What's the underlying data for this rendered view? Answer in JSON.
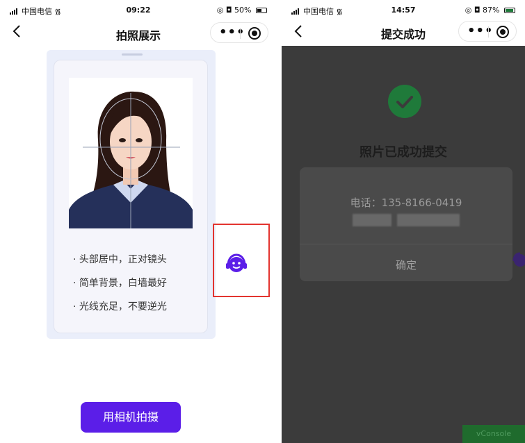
{
  "left": {
    "status": {
      "carrier": "中国电信",
      "time": "09:22",
      "battery": "50%"
    },
    "nav": {
      "back": "<",
      "title": "拍照展示"
    },
    "tips": [
      "· 头部居中，正对镜头",
      "· 简单背景，白墙最好",
      "· 光线充足，不要逆光"
    ],
    "camera_button": "用相机拍摄"
  },
  "right": {
    "status": {
      "carrier": "中国电信",
      "time": "14:57",
      "battery": "87%"
    },
    "nav": {
      "back": "<",
      "title": "提交成功"
    },
    "success_text": "照片已成功提交",
    "dialog": {
      "phone": "电话：135-8166-0419",
      "confirm": "确定"
    },
    "vconsole": "vConsole"
  },
  "colors": {
    "primary": "#5b1ee8",
    "success": "#1f7a3a",
    "highlight": "#e3342f",
    "overlay": "#3b3b3b"
  }
}
